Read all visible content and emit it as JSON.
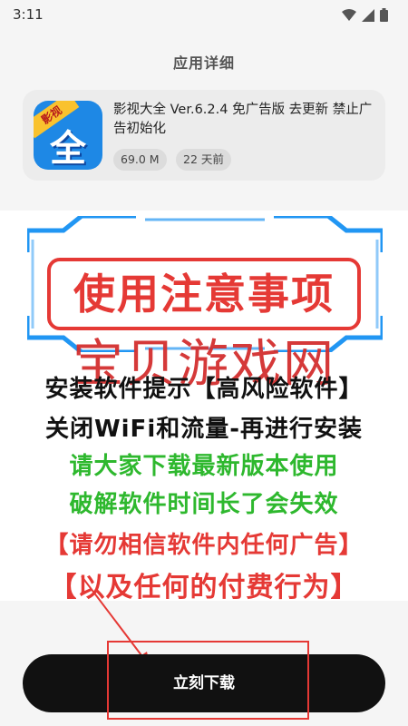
{
  "status_bar": {
    "time": "3:11",
    "icons": [
      "wifi-icon",
      "signal-icon",
      "battery-icon"
    ]
  },
  "page": {
    "title": "应用详细"
  },
  "app": {
    "icon_ribbon": "影视",
    "icon_glyph": "全",
    "name": "影视大全 Ver.6.2.4 免广告版 去更新 禁止广告初始化",
    "size": "69.0 M",
    "updated": "22 天前"
  },
  "banner": {
    "title": "使用注意事项",
    "watermark": "宝贝游戏网",
    "lines": [
      "安装软件提示【高风险软件】",
      "关闭WiFi和流量-再进行安装",
      "请大家下载最新版本使用",
      "破解软件时间长了会失效",
      "【请勿相信软件内任何广告】",
      "【以及任何的付费行为】"
    ],
    "colors": {
      "black": "#111111",
      "green": "#2eb82e",
      "red": "#e53935",
      "frame_blue": "#2196f3"
    }
  },
  "action": {
    "download_label": "立刻下载"
  }
}
